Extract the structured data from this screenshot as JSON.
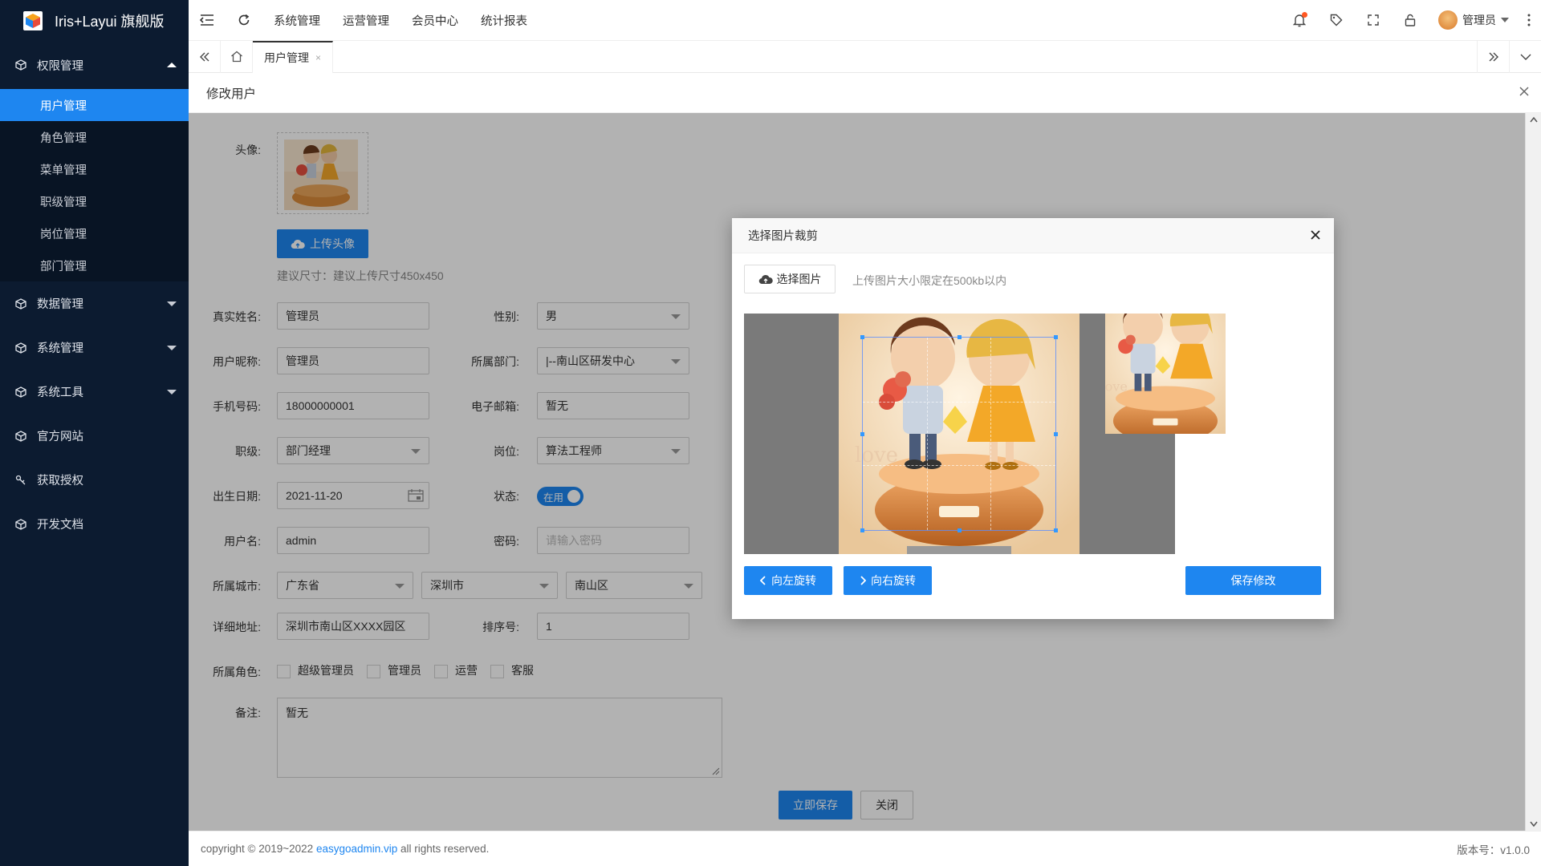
{
  "app": {
    "title": "Iris+Layui 旗舰版"
  },
  "sidebar": {
    "groups": [
      {
        "label": "权限管理",
        "expanded": true,
        "items": [
          "用户管理",
          "角色管理",
          "菜单管理",
          "职级管理",
          "岗位管理",
          "部门管理"
        ],
        "active": "用户管理"
      },
      {
        "label": "数据管理"
      },
      {
        "label": "系统管理"
      },
      {
        "label": "系统工具"
      },
      {
        "label": "官方网站"
      },
      {
        "label": "获取授权"
      },
      {
        "label": "开发文档"
      }
    ]
  },
  "header": {
    "nav": [
      "系统管理",
      "运营管理",
      "会员中心",
      "统计报表"
    ],
    "active_nav": "系统管理",
    "user": "管理员"
  },
  "tabs": {
    "home_icon": "home-icon",
    "items": [
      {
        "label": "用户管理",
        "close": "×"
      }
    ]
  },
  "page": {
    "title": "修改用户"
  },
  "form": {
    "avatar_label": "头像:",
    "upload_avatar": "上传头像",
    "size_hint": "建议尺寸：建议上传尺寸450x450",
    "realname_label": "真实姓名:",
    "realname": "管理员",
    "gender_label": "性别:",
    "gender": "男",
    "nickname_label": "用户昵称:",
    "nickname": "管理员",
    "dept_label": "所属部门:",
    "dept": "|--南山区研发中心",
    "mobile_label": "手机号码:",
    "mobile": "18000000001",
    "email_label": "电子邮箱:",
    "email": "暂无",
    "level_label": "职级:",
    "level": "部门经理",
    "position_label": "岗位:",
    "position": "算法工程师",
    "birthday_label": "出生日期:",
    "birthday": "2021-11-20",
    "status_label": "状态:",
    "status": "在用",
    "username_label": "用户名:",
    "username": "admin",
    "password_label": "密码:",
    "password_placeholder": "请输入密码",
    "city_label": "所属城市:",
    "province": "广东省",
    "city": "深圳市",
    "district": "南山区",
    "address_label": "详细地址:",
    "address": "深圳市南山区XXXX园区",
    "sort_label": "排序号:",
    "sort": "1",
    "roles_label": "所属角色:",
    "roles": [
      "超级管理员",
      "管理员",
      "运营",
      "客服"
    ],
    "remark_label": "备注:",
    "remark": "暂无",
    "save": "立即保存",
    "close": "关闭"
  },
  "footer": {
    "copyright_pre": "copyright © 2019~2022",
    "link": "easygoadmin.vip",
    "copyright_post": "all rights reserved.",
    "version": "版本号：v1.0.0"
  },
  "modal": {
    "title": "选择图片裁剪",
    "select": "选择图片",
    "hint": "上传图片大小限定在500kb以内",
    "rotate_left": "向左旋转",
    "rotate_right": "向右旋转",
    "save": "保存修改"
  },
  "colors": {
    "sidebar": "#0c1b30",
    "accent": "#1e86f0"
  }
}
